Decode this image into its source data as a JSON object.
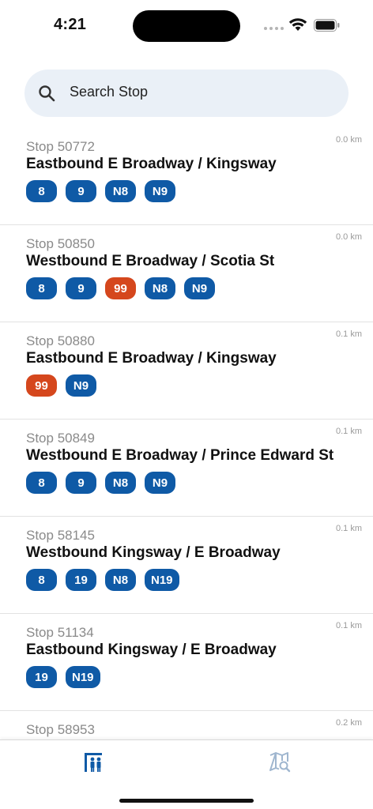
{
  "status_bar": {
    "time": "4:21"
  },
  "search": {
    "placeholder": "Search Stop"
  },
  "stops": [
    {
      "code": "Stop 50772",
      "name": "Eastbound E Broadway / Kingsway",
      "distance": "0.0 km",
      "routes": [
        {
          "label": "8",
          "type": "regular"
        },
        {
          "label": "9",
          "type": "regular"
        },
        {
          "label": "N8",
          "type": "regular"
        },
        {
          "label": "N9",
          "type": "regular"
        }
      ]
    },
    {
      "code": "Stop 50850",
      "name": "Westbound E Broadway / Scotia St",
      "distance": "0.0 km",
      "routes": [
        {
          "label": "8",
          "type": "regular"
        },
        {
          "label": "9",
          "type": "regular"
        },
        {
          "label": "99",
          "type": "express"
        },
        {
          "label": "N8",
          "type": "regular"
        },
        {
          "label": "N9",
          "type": "regular"
        }
      ]
    },
    {
      "code": "Stop 50880",
      "name": "Eastbound E Broadway / Kingsway",
      "distance": "0.1 km",
      "routes": [
        {
          "label": "99",
          "type": "express"
        },
        {
          "label": "N9",
          "type": "regular"
        }
      ]
    },
    {
      "code": "Stop 50849",
      "name": "Westbound E Broadway / Prince Edward St",
      "distance": "0.1 km",
      "routes": [
        {
          "label": "8",
          "type": "regular"
        },
        {
          "label": "9",
          "type": "regular"
        },
        {
          "label": "N8",
          "type": "regular"
        },
        {
          "label": "N9",
          "type": "regular"
        }
      ]
    },
    {
      "code": "Stop 58145",
      "name": "Westbound Kingsway / E Broadway",
      "distance": "0.1 km",
      "routes": [
        {
          "label": "8",
          "type": "regular"
        },
        {
          "label": "19",
          "type": "regular"
        },
        {
          "label": "N8",
          "type": "regular"
        },
        {
          "label": "N19",
          "type": "regular"
        }
      ]
    },
    {
      "code": "Stop 51134",
      "name": "Eastbound Kingsway / E Broadway",
      "distance": "0.1 km",
      "routes": [
        {
          "label": "19",
          "type": "regular"
        },
        {
          "label": "N19",
          "type": "regular"
        }
      ]
    },
    {
      "code": "Stop 58953",
      "name": "",
      "distance": "0.2 km",
      "routes": []
    }
  ],
  "tab_bar": {
    "tabs": [
      {
        "name": "stops-tab",
        "icon": "bus-stop-icon",
        "active": true
      },
      {
        "name": "map-tab",
        "icon": "map-search-icon",
        "active": false
      }
    ]
  },
  "colors": {
    "regular_route": "#0f5aa6",
    "express_route": "#d5471d",
    "search_bg": "#eaf0f7",
    "active_tab": "#0f5aa6",
    "inactive_tab": "#9fb6cf"
  }
}
